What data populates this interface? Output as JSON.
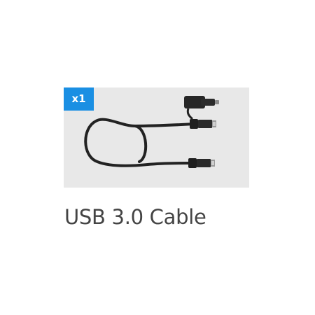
{
  "product": {
    "quantity_badge": "x1",
    "image_icon": "usb-cable-icon",
    "title": "USB 3.0 Cable"
  },
  "colors": {
    "badge_background": "#1a8fe3",
    "image_background": "#e8e8e8",
    "title_text": "#444444",
    "cable": "#222222"
  }
}
